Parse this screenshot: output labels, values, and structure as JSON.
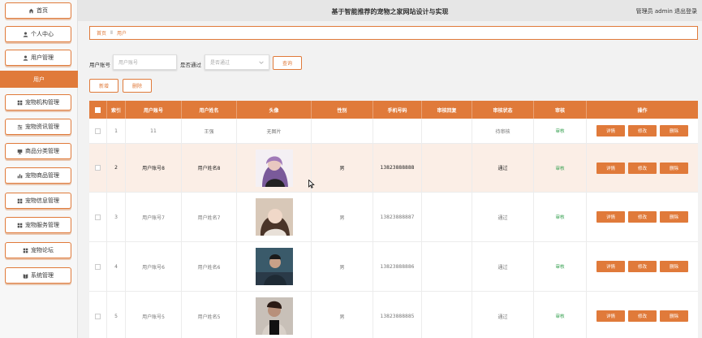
{
  "header": {
    "title": "基于智能推荐的宠物之家网站设计与实现",
    "user_text": "管理员 admin  退出登录"
  },
  "sidebar": {
    "items": [
      {
        "label": "首页",
        "icon": "home-icon"
      },
      {
        "label": "个人中心",
        "icon": "user-icon"
      },
      {
        "label": "用户管理",
        "icon": "user-icon"
      },
      {
        "label": "宠物机构管理",
        "icon": "grid-icon"
      },
      {
        "label": "宠物资讯管理",
        "icon": "sliders-icon"
      },
      {
        "label": "商品分类管理",
        "icon": "monitor-icon"
      },
      {
        "label": "宠物商品管理",
        "icon": "bar-chart-icon"
      },
      {
        "label": "宠物信息管理",
        "icon": "grid-icon"
      },
      {
        "label": "宠物服务管理",
        "icon": "grid-icon"
      },
      {
        "label": "宠物论坛",
        "icon": "grid-icon"
      },
      {
        "label": "系统管理",
        "icon": "book-icon"
      }
    ],
    "active_sub": "用户"
  },
  "breadcrumb": {
    "home": "首页",
    "sep": "Ⅱ",
    "current": "用户"
  },
  "search": {
    "account_label": "用户账号",
    "account_placeholder": "用户账号",
    "pass_label": "是否通过",
    "pass_placeholder": "是否通过",
    "query_button": "查询"
  },
  "actions": {
    "add": "新增",
    "delete": "删除"
  },
  "table": {
    "headers": [
      "",
      "索引",
      "用户账号",
      "用户姓名",
      "头像",
      "性别",
      "手机号码",
      "审核回复",
      "审核状态",
      "审核",
      "操作"
    ],
    "rows": [
      {
        "index": "1",
        "account": "11",
        "name": "王强",
        "avatar": "无图片",
        "gender": "",
        "phone": "",
        "reply": "",
        "status": "待审核",
        "audit": "审核"
      },
      {
        "index": "2",
        "account": "用户账号8",
        "name": "用户姓名8",
        "avatar": "",
        "gender": "男",
        "phone": "13823888888",
        "reply": "",
        "status": "通过",
        "audit": "审核"
      },
      {
        "index": "3",
        "account": "用户账号7",
        "name": "用户姓名7",
        "avatar": "",
        "gender": "男",
        "phone": "13823888887",
        "reply": "",
        "status": "通过",
        "audit": "审核"
      },
      {
        "index": "4",
        "account": "用户账号6",
        "name": "用户姓名6",
        "avatar": "",
        "gender": "男",
        "phone": "13823888886",
        "reply": "",
        "status": "通过",
        "audit": "审核"
      },
      {
        "index": "5",
        "account": "用户账号5",
        "name": "用户姓名5",
        "avatar": "",
        "gender": "男",
        "phone": "13823888885",
        "reply": "",
        "status": "通过",
        "audit": "审核"
      }
    ],
    "op_labels": {
      "detail": "详情",
      "edit": "修改",
      "delete": "删除"
    }
  }
}
